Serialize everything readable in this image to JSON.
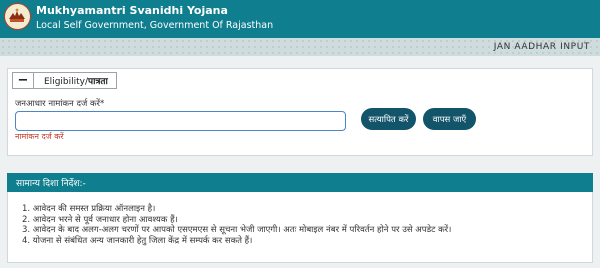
{
  "header": {
    "title": "Mukhyamantri Svanidhi Yojana",
    "subtitle": "Local Self Government, Government Of Rajasthan"
  },
  "subbar": {
    "label": "JAN AADHAR INPUT"
  },
  "eligibility": {
    "collapse_symbol": "−",
    "legend_prefix": "Eligibility/",
    "legend_bold": "पात्रता",
    "field_label": "जनआधार नामांकन दर्ज करें*",
    "input_value": "",
    "input_placeholder": "",
    "error_text": "नामांकन दर्ज करें",
    "verify_button": "सत्यापित करें",
    "back_button": "वापस जाएँ"
  },
  "instructions": {
    "heading": "सामान्य दिशा निर्देश:-",
    "items": [
      "1. आवेदन की समस्त प्रक्रिया ऑनलाइन है।",
      "2. आवेदन भरने से पूर्व जनाधार होना आवश्यक हैं।",
      "3. आवेदन के बाद अलग-अलग चरणों पर आपको एसएमएस से सूचना भेजी जाएगी। अतः मोबाइल नंबर में परिवर्तन होने पर उसे अपडेट करें।",
      "4. योजना से संबंधित अन्य जानकारी हेतु जिला केंद्र में सम्पर्क कर सकते हैं।"
    ]
  },
  "colors": {
    "header_bg": "#0f7e8f",
    "button_bg": "#12546a",
    "error": "#c43b2b"
  }
}
